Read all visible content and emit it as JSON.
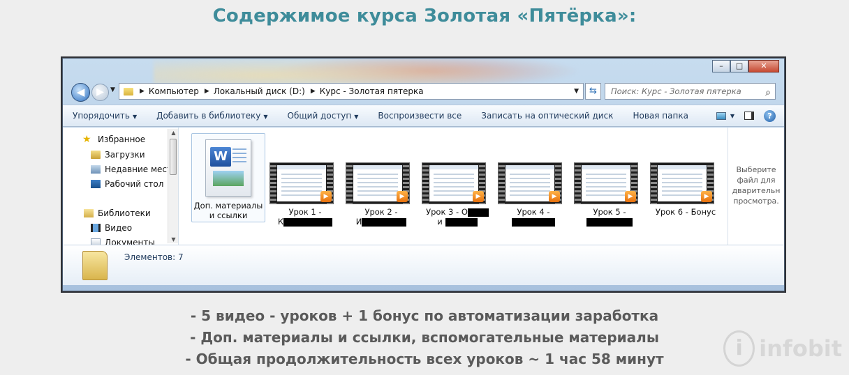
{
  "heading": "Содержимое курса Золотая «Пятёрка»:",
  "window": {
    "caption_buttons": {
      "minimize": "–",
      "maximize": "□",
      "close": "✕"
    },
    "breadcrumbs": [
      "Компьютер",
      "Локальный диск (D:)",
      "Курс - Золотая пятерка"
    ],
    "search_placeholder": "Поиск: Курс - Золотая пятерка",
    "toolbar": {
      "organize": "Упорядочить",
      "add_to_library": "Добавить в библиотеку",
      "share": "Общий доступ",
      "play_all": "Воспроизвести все",
      "burn": "Записать на оптический диск",
      "new_folder": "Новая папка",
      "help": "?"
    },
    "nav": {
      "favorites": "Избранное",
      "downloads": "Загрузки",
      "recent": "Недавние места",
      "desktop": "Рабочий стол",
      "libraries": "Библиотеки",
      "video": "Видео",
      "documents": "Документы"
    },
    "files": [
      {
        "line1": "Доп. материалы",
        "line2": "и ссылки",
        "type": "word-document-icon"
      },
      {
        "line1": "Урок 1 -",
        "line2": "К",
        "type": "video-file-icon"
      },
      {
        "line1": "Урок 2 -",
        "line2": "И",
        "type": "video-file-icon"
      },
      {
        "line1": "Урок 3 - О",
        "line2": "и",
        "type": "video-file-icon"
      },
      {
        "line1": "Урок 4 -",
        "line2": "",
        "type": "video-file-icon"
      },
      {
        "line1": "Урок 5 -",
        "line2": "",
        "type": "video-file-icon"
      },
      {
        "line1": "Урок 6 - Бонус",
        "line2": "",
        "type": "video-file-icon"
      }
    ],
    "preview_text": [
      "Выберите",
      "файл для",
      "дварительн",
      "просмотра."
    ],
    "status": "Элементов: 7"
  },
  "features": [
    "- 5 видео - уроков + 1 бонус по автоматизации заработка",
    "- Доп. материалы и ссылки, вспомогательные материалы",
    "- Общая продолжительность всех уроков ~ 1 час 58 минут"
  ],
  "watermark": {
    "symbol": "i",
    "text": "infobit"
  },
  "colors": {
    "heading": "#3e8c9a",
    "feature_text": "#5a5a5a",
    "toolbar_text": "#1e395b",
    "close_button": "#c74a32"
  }
}
